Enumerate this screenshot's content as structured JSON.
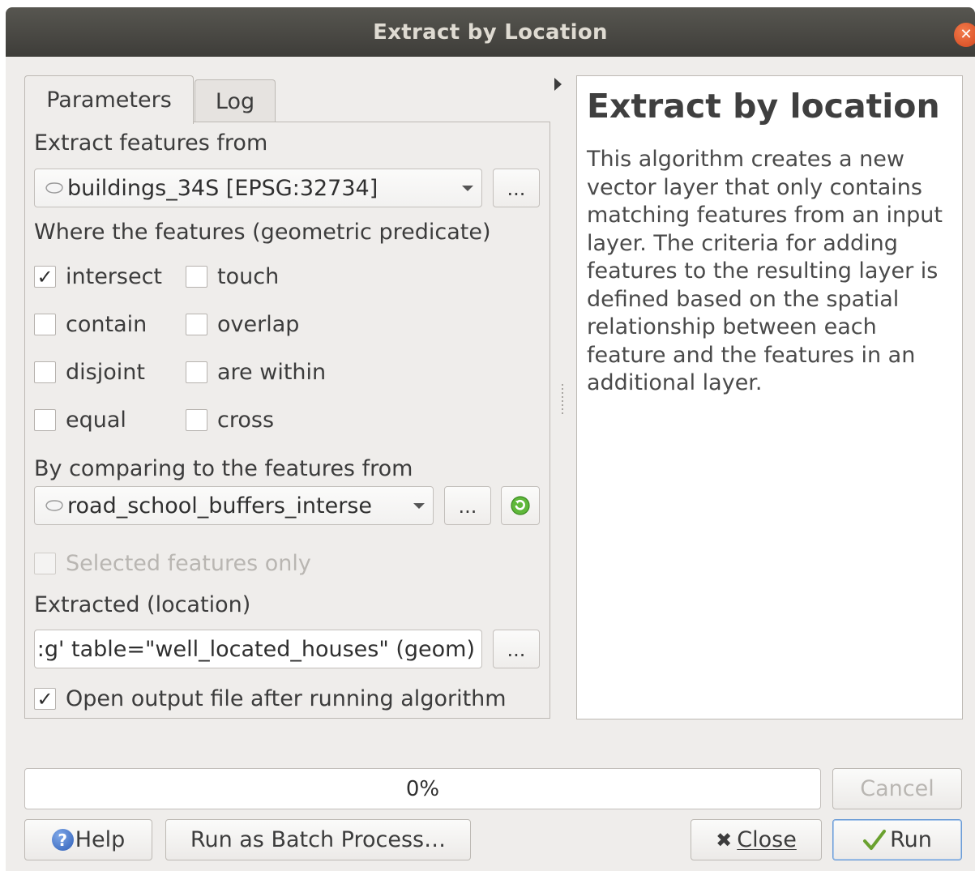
{
  "window": {
    "title": "Extract by Location"
  },
  "tabs": [
    {
      "label": "Parameters"
    },
    {
      "label": "Log"
    }
  ],
  "params": {
    "input_label": "Extract features from",
    "input_layer": "buildings_34S [EPSG:32734]",
    "predicate_label": "Where the features (geometric predicate)",
    "predicates": {
      "intersect": {
        "label": "intersect",
        "checked": true
      },
      "touch": {
        "label": "touch",
        "checked": false
      },
      "contain": {
        "label": "contain",
        "checked": false
      },
      "overlap": {
        "label": "overlap",
        "checked": false
      },
      "disjoint": {
        "label": "disjoint",
        "checked": false
      },
      "are_within": {
        "label": "are within",
        "checked": false
      },
      "equal": {
        "label": "equal",
        "checked": false
      },
      "cross": {
        "label": "cross",
        "checked": false
      }
    },
    "compare_label": "By comparing to the features from",
    "compare_layer": "road_school_buffers_interse",
    "selected_only_label": "Selected features only",
    "output_label": "Extracted (location)",
    "output_value": ":g' table=\"well_located_houses\" (geom)",
    "open_output_label": "Open output file after running algorithm",
    "dots": "..."
  },
  "help": {
    "title": "Extract by location",
    "body": "This algorithm creates a new vector layer that only contains matching features from an input layer. The criteria for adding features to the resulting layer is defined based on the spatial relationship between each feature and the features in an additional layer."
  },
  "progress": {
    "value": 0,
    "text": "0%"
  },
  "buttons": {
    "cancel": "Cancel",
    "help": "Help",
    "batch": "Run as Batch Process…",
    "close": "Close",
    "run": "Run"
  },
  "icons": {
    "close_window": "close-x",
    "layer": "polygon-layer-icon",
    "refresh": "green-refresh-icon",
    "help": "help-circle-icon",
    "close": "x-mark-icon",
    "run": "checkmark-icon"
  }
}
